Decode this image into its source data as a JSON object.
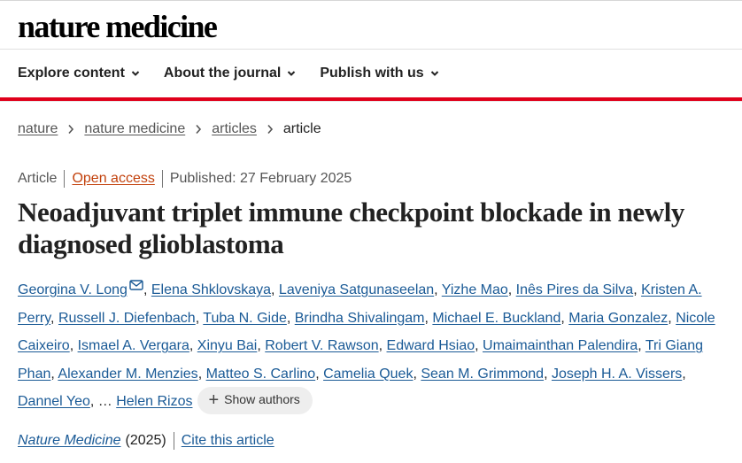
{
  "header": {
    "brand": "nature medicine",
    "nav": [
      {
        "label": "Explore content"
      },
      {
        "label": "About the journal"
      },
      {
        "label": "Publish with us"
      }
    ]
  },
  "breadcrumb": {
    "items": [
      "nature",
      "nature medicine",
      "articles"
    ],
    "current": "article"
  },
  "meta": {
    "type": "Article",
    "access": "Open access",
    "published": "Published: 27 February 2025"
  },
  "title": "Neoadjuvant triplet immune checkpoint blockade in newly diagnosed glioblastoma",
  "authors": [
    "Georgina V. Long",
    "Elena Shklovskaya",
    "Laveniya Satgunaseelan",
    "Yizhe Mao",
    "Inês Pires da Silva",
    "Kristen A. Perry",
    "Russell J. Diefenbach",
    "Tuba N. Gide",
    "Brindha Shivalingam",
    "Michael E. Buckland",
    "Maria Gonzalez",
    "Nicole Caixeiro",
    "Ismael A. Vergara",
    "Xinyu Bai",
    "Robert V. Rawson",
    "Edward Hsiao",
    "Umaimainthan Palendira",
    "Tri Giang Phan",
    "Alexander M. Menzies",
    "Matteo S. Carlino",
    "Camelia Quek",
    "Sean M. Grimmond",
    "Joseph H. A. Vissers",
    "Dannel Yeo"
  ],
  "ellipsis": "…",
  "last_author": "Helen Rizos",
  "show_authors_label": "Show authors",
  "citation": {
    "journal": "Nature Medicine",
    "year": "(2025)",
    "cite_label": "Cite this article"
  },
  "colors": {
    "accent_red": "#e0001b",
    "link_blue": "#1a5a96",
    "open_access": "#c2410c"
  }
}
